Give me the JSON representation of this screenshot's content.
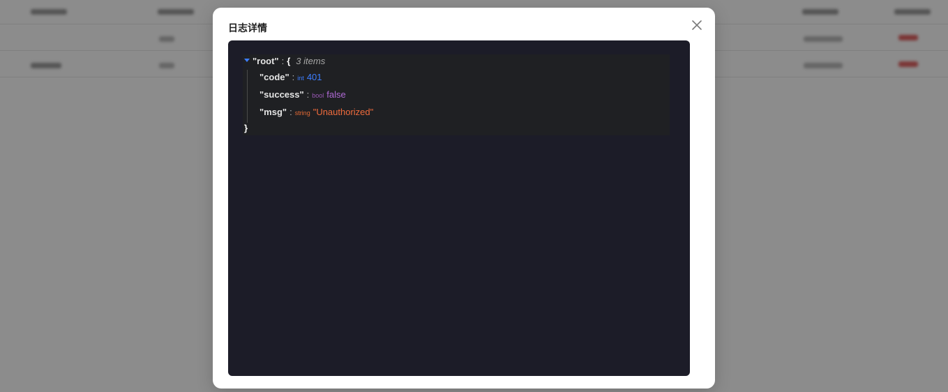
{
  "modal": {
    "title": "日志详情",
    "close_icon": "close-icon"
  },
  "json_view": {
    "root_key": "\"root\"",
    "colon": ":",
    "open_brace": "{",
    "close_brace": "}",
    "item_count": "3 items",
    "fields": [
      {
        "key": "\"code\"",
        "type": "int",
        "value": "401"
      },
      {
        "key": "\"success\"",
        "type": "bool",
        "value": "false"
      },
      {
        "key": "\"msg\"",
        "type": "string",
        "value": "\"Unauthorized\""
      }
    ]
  },
  "colors": {
    "panel_bg": "#1c1c28",
    "int": "#3d7eff",
    "bool": "#b06ad6",
    "string": "#f06b3c",
    "overlay": "rgba(0,0,0,0.45)"
  }
}
